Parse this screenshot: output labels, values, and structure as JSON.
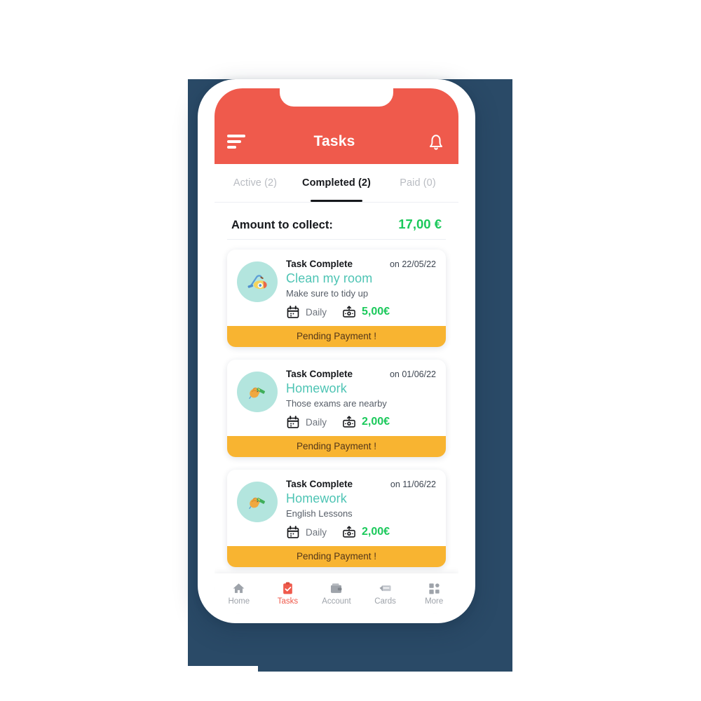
{
  "colors": {
    "backdrop_navy": "#2a4a67",
    "header_red": "#ef5a4c",
    "accent_green": "#1bc95b",
    "task_teal": "#4ec4b4",
    "pending_amber": "#f8b431",
    "avatar_mint": "#b3e5de",
    "page_background": "#ffffff"
  },
  "header": {
    "title": "Tasks",
    "menu_icon": "hamburger-icon",
    "bell_icon": "bell-icon"
  },
  "tabs": [
    {
      "label": "Active (2)",
      "active": false
    },
    {
      "label": "Completed (2)",
      "active": true
    },
    {
      "label": "Paid (0)",
      "active": false
    }
  ],
  "summary": {
    "label": "Amount to collect:",
    "value": "17,00 €"
  },
  "tasks": [
    {
      "icon": "vacuum-cleaner-icon",
      "emoji": "🧹",
      "status": "Task Complete",
      "date": "on 22/05/22",
      "title": "Clean my room",
      "description": "Make sure to tidy up",
      "frequency": "Daily",
      "frequency_icon": "calendar-icon",
      "price": "5,00€",
      "price_icon": "payment-icon",
      "action_label": "Pending Payment !"
    },
    {
      "icon": "writing-hand-icon",
      "emoji": "✍",
      "status": "Task Complete",
      "date": "on 01/06/22",
      "title": "Homework",
      "description": "Those exams are nearby",
      "frequency": "Daily",
      "frequency_icon": "calendar-icon",
      "price": "2,00€",
      "price_icon": "payment-icon",
      "action_label": "Pending Payment !"
    },
    {
      "icon": "writing-hand-icon",
      "emoji": "✍",
      "status": "Task Complete",
      "date": "on 11/06/22",
      "title": "Homework",
      "description": "English Lessons",
      "frequency": "Daily",
      "frequency_icon": "calendar-icon",
      "price": "2,00€",
      "price_icon": "payment-icon",
      "action_label": "Pending Payment !"
    }
  ],
  "bottom_nav": [
    {
      "label": "Home",
      "icon": "home-icon",
      "active": false
    },
    {
      "label": "Tasks",
      "icon": "clipboard-icon",
      "active": true
    },
    {
      "label": "Account",
      "icon": "wallet-icon",
      "active": false
    },
    {
      "label": "Cards",
      "icon": "card-icon",
      "active": false
    },
    {
      "label": "More",
      "icon": "grid-icon",
      "active": false
    }
  ]
}
